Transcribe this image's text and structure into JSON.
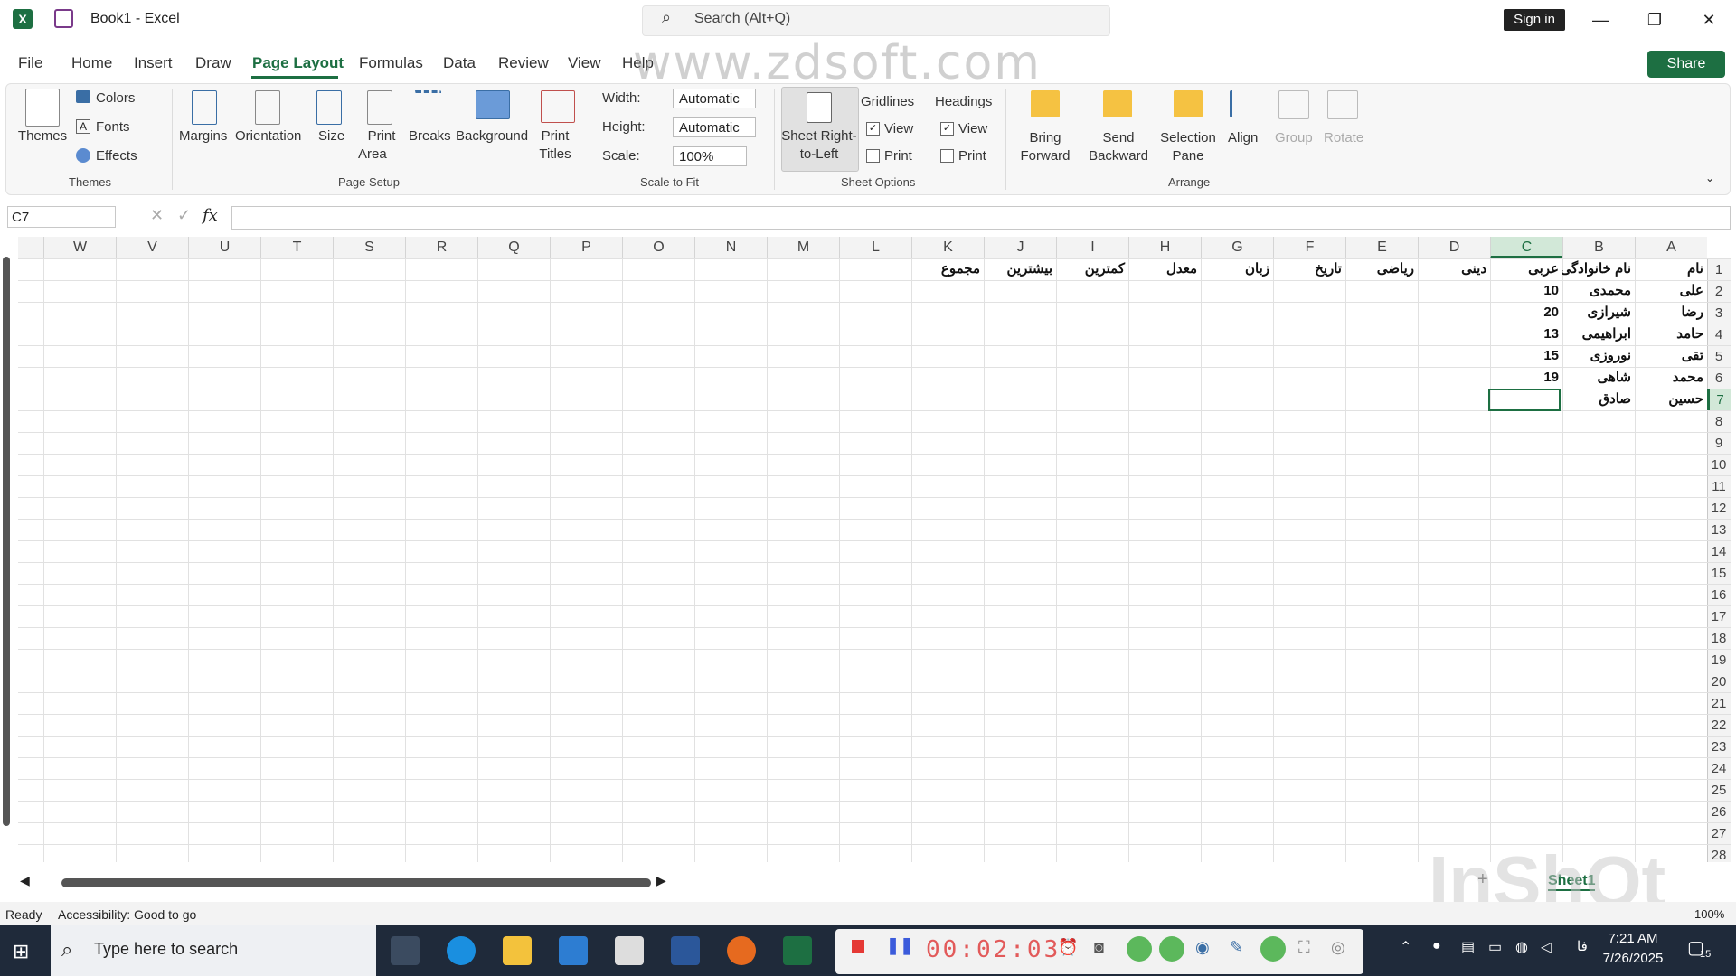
{
  "window": {
    "title": "Book1  -  Excel",
    "search_placeholder": "Search (Alt+Q)",
    "signin": "Sign in"
  },
  "tabs": [
    "File",
    "Home",
    "Insert",
    "Draw",
    "Page Layout",
    "Formulas",
    "Data",
    "Review",
    "View",
    "Help"
  ],
  "share_label": "Share",
  "watermark": "www.zdsoft.com",
  "ribbon": {
    "themes": {
      "themes_label": "Themes",
      "colors": "Colors",
      "fonts": "Fonts",
      "effects": "Effects",
      "group": "Themes"
    },
    "page_setup": {
      "margins": "Margins",
      "orientation": "Orientation",
      "size": "Size",
      "print_area_1": "Print",
      "print_area_2": "Area",
      "breaks": "Breaks",
      "background": "Background",
      "print_titles_1": "Print",
      "print_titles_2": "Titles",
      "group": "Page Setup"
    },
    "scale": {
      "width_label": "Width:",
      "width_value": "Automatic",
      "height_label": "Height:",
      "height_value": "Automatic",
      "scale_label": "Scale:",
      "scale_value": "100%",
      "group": "Scale to Fit"
    },
    "sheet_rtl": {
      "line1": "Sheet Right-",
      "line2": "to-Left"
    },
    "sheet_options": {
      "gridlines": "Gridlines",
      "headings": "Headings",
      "view": "View",
      "print": "Print",
      "group": "Sheet Options"
    },
    "arrange": {
      "bring_1": "Bring",
      "bring_2": "Forward",
      "send_1": "Send",
      "send_2": "Backward",
      "selection_1": "Selection",
      "selection_2": "Pane",
      "align": "Align",
      "group_btn": "Group",
      "rotate": "Rotate",
      "group": "Arrange"
    }
  },
  "formula_bar": {
    "name_box": "C7",
    "fx": "fx",
    "value": ""
  },
  "columns": [
    "W",
    "V",
    "U",
    "T",
    "S",
    "R",
    "Q",
    "P",
    "O",
    "N",
    "M",
    "L",
    "K",
    "J",
    "I",
    "H",
    "G",
    "F",
    "E",
    "D",
    "C",
    "B",
    "A"
  ],
  "rows": [
    "1",
    "2",
    "3",
    "4",
    "5",
    "6",
    "7",
    "8",
    "9",
    "10",
    "11",
    "12",
    "13",
    "14",
    "15",
    "16",
    "17",
    "18",
    "19",
    "20",
    "21",
    "22",
    "23",
    "24",
    "25",
    "26",
    "27",
    "28"
  ],
  "cells": {
    "header": {
      "A": "نام",
      "B": "نام خانوادگی",
      "C": "عربی",
      "D": "دینی",
      "E": "ریاضی",
      "F": "تاریخ",
      "G": "زبان",
      "H": "معدل",
      "I": "کمترین",
      "J": "بیشترین",
      "K": "مجموع"
    },
    "rows": [
      {
        "A": "علی",
        "B": "محمدی",
        "C": "10"
      },
      {
        "A": "رضا",
        "B": "شیرازی",
        "C": "20"
      },
      {
        "A": "حامد",
        "B": "ابراهیمی",
        "C": "13"
      },
      {
        "A": "تقی",
        "B": "نوروزی",
        "C": "15"
      },
      {
        "A": "محمد",
        "B": "شاهی",
        "C": "19"
      },
      {
        "A": "حسین",
        "B": "صادق",
        "C": ""
      }
    ]
  },
  "sheet_tab": "Sheet1",
  "status": {
    "ready": "Ready",
    "accessibility": "Accessibility: Good to go",
    "zoom": "100%"
  },
  "taskbar": {
    "search_placeholder": "Type here to search",
    "recorder_time": "00:02:03",
    "time": "7:21 AM",
    "date": "7/26/2025",
    "lang": "فا",
    "notif_count": "15",
    "inshot": "InShOt"
  }
}
